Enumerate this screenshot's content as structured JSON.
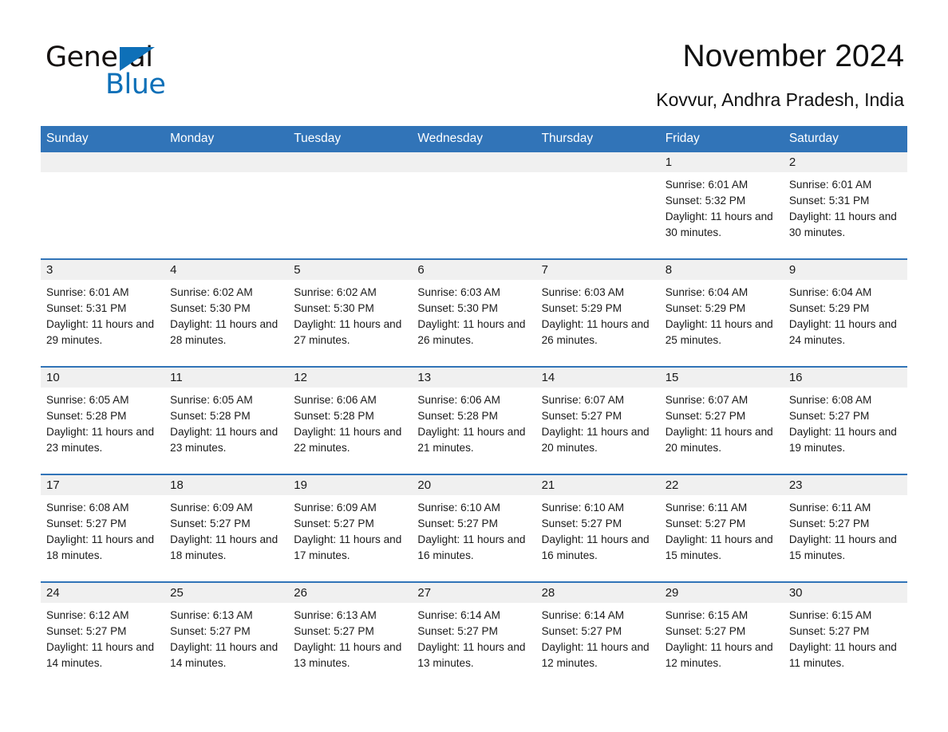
{
  "brand": {
    "name_part1": "General",
    "name_part2": "Blue",
    "accent_color": "#0e70b8"
  },
  "header": {
    "title": "November 2024",
    "location": "Kovvur, Andhra Pradesh, India"
  },
  "calendar": {
    "header_bg": "#3174b8",
    "daynum_bg": "#f0f0f0",
    "weekday_headers": [
      "Sunday",
      "Monday",
      "Tuesday",
      "Wednesday",
      "Thursday",
      "Friday",
      "Saturday"
    ],
    "weeks": [
      [
        {
          "day": "",
          "blank": true,
          "sunrise": "",
          "sunset": "",
          "daylight": ""
        },
        {
          "day": "",
          "blank": true,
          "sunrise": "",
          "sunset": "",
          "daylight": ""
        },
        {
          "day": "",
          "blank": true,
          "sunrise": "",
          "sunset": "",
          "daylight": ""
        },
        {
          "day": "",
          "blank": true,
          "sunrise": "",
          "sunset": "",
          "daylight": ""
        },
        {
          "day": "",
          "blank": true,
          "sunrise": "",
          "sunset": "",
          "daylight": ""
        },
        {
          "day": "1",
          "blank": false,
          "sunrise": "Sunrise: 6:01 AM",
          "sunset": "Sunset: 5:32 PM",
          "daylight": "Daylight: 11 hours and 30 minutes."
        },
        {
          "day": "2",
          "blank": false,
          "sunrise": "Sunrise: 6:01 AM",
          "sunset": "Sunset: 5:31 PM",
          "daylight": "Daylight: 11 hours and 30 minutes."
        }
      ],
      [
        {
          "day": "3",
          "blank": false,
          "sunrise": "Sunrise: 6:01 AM",
          "sunset": "Sunset: 5:31 PM",
          "daylight": "Daylight: 11 hours and 29 minutes."
        },
        {
          "day": "4",
          "blank": false,
          "sunrise": "Sunrise: 6:02 AM",
          "sunset": "Sunset: 5:30 PM",
          "daylight": "Daylight: 11 hours and 28 minutes."
        },
        {
          "day": "5",
          "blank": false,
          "sunrise": "Sunrise: 6:02 AM",
          "sunset": "Sunset: 5:30 PM",
          "daylight": "Daylight: 11 hours and 27 minutes."
        },
        {
          "day": "6",
          "blank": false,
          "sunrise": "Sunrise: 6:03 AM",
          "sunset": "Sunset: 5:30 PM",
          "daylight": "Daylight: 11 hours and 26 minutes."
        },
        {
          "day": "7",
          "blank": false,
          "sunrise": "Sunrise: 6:03 AM",
          "sunset": "Sunset: 5:29 PM",
          "daylight": "Daylight: 11 hours and 26 minutes."
        },
        {
          "day": "8",
          "blank": false,
          "sunrise": "Sunrise: 6:04 AM",
          "sunset": "Sunset: 5:29 PM",
          "daylight": "Daylight: 11 hours and 25 minutes."
        },
        {
          "day": "9",
          "blank": false,
          "sunrise": "Sunrise: 6:04 AM",
          "sunset": "Sunset: 5:29 PM",
          "daylight": "Daylight: 11 hours and 24 minutes."
        }
      ],
      [
        {
          "day": "10",
          "blank": false,
          "sunrise": "Sunrise: 6:05 AM",
          "sunset": "Sunset: 5:28 PM",
          "daylight": "Daylight: 11 hours and 23 minutes."
        },
        {
          "day": "11",
          "blank": false,
          "sunrise": "Sunrise: 6:05 AM",
          "sunset": "Sunset: 5:28 PM",
          "daylight": "Daylight: 11 hours and 23 minutes."
        },
        {
          "day": "12",
          "blank": false,
          "sunrise": "Sunrise: 6:06 AM",
          "sunset": "Sunset: 5:28 PM",
          "daylight": "Daylight: 11 hours and 22 minutes."
        },
        {
          "day": "13",
          "blank": false,
          "sunrise": "Sunrise: 6:06 AM",
          "sunset": "Sunset: 5:28 PM",
          "daylight": "Daylight: 11 hours and 21 minutes."
        },
        {
          "day": "14",
          "blank": false,
          "sunrise": "Sunrise: 6:07 AM",
          "sunset": "Sunset: 5:27 PM",
          "daylight": "Daylight: 11 hours and 20 minutes."
        },
        {
          "day": "15",
          "blank": false,
          "sunrise": "Sunrise: 6:07 AM",
          "sunset": "Sunset: 5:27 PM",
          "daylight": "Daylight: 11 hours and 20 minutes."
        },
        {
          "day": "16",
          "blank": false,
          "sunrise": "Sunrise: 6:08 AM",
          "sunset": "Sunset: 5:27 PM",
          "daylight": "Daylight: 11 hours and 19 minutes."
        }
      ],
      [
        {
          "day": "17",
          "blank": false,
          "sunrise": "Sunrise: 6:08 AM",
          "sunset": "Sunset: 5:27 PM",
          "daylight": "Daylight: 11 hours and 18 minutes."
        },
        {
          "day": "18",
          "blank": false,
          "sunrise": "Sunrise: 6:09 AM",
          "sunset": "Sunset: 5:27 PM",
          "daylight": "Daylight: 11 hours and 18 minutes."
        },
        {
          "day": "19",
          "blank": false,
          "sunrise": "Sunrise: 6:09 AM",
          "sunset": "Sunset: 5:27 PM",
          "daylight": "Daylight: 11 hours and 17 minutes."
        },
        {
          "day": "20",
          "blank": false,
          "sunrise": "Sunrise: 6:10 AM",
          "sunset": "Sunset: 5:27 PM",
          "daylight": "Daylight: 11 hours and 16 minutes."
        },
        {
          "day": "21",
          "blank": false,
          "sunrise": "Sunrise: 6:10 AM",
          "sunset": "Sunset: 5:27 PM",
          "daylight": "Daylight: 11 hours and 16 minutes."
        },
        {
          "day": "22",
          "blank": false,
          "sunrise": "Sunrise: 6:11 AM",
          "sunset": "Sunset: 5:27 PM",
          "daylight": "Daylight: 11 hours and 15 minutes."
        },
        {
          "day": "23",
          "blank": false,
          "sunrise": "Sunrise: 6:11 AM",
          "sunset": "Sunset: 5:27 PM",
          "daylight": "Daylight: 11 hours and 15 minutes."
        }
      ],
      [
        {
          "day": "24",
          "blank": false,
          "sunrise": "Sunrise: 6:12 AM",
          "sunset": "Sunset: 5:27 PM",
          "daylight": "Daylight: 11 hours and 14 minutes."
        },
        {
          "day": "25",
          "blank": false,
          "sunrise": "Sunrise: 6:13 AM",
          "sunset": "Sunset: 5:27 PM",
          "daylight": "Daylight: 11 hours and 14 minutes."
        },
        {
          "day": "26",
          "blank": false,
          "sunrise": "Sunrise: 6:13 AM",
          "sunset": "Sunset: 5:27 PM",
          "daylight": "Daylight: 11 hours and 13 minutes."
        },
        {
          "day": "27",
          "blank": false,
          "sunrise": "Sunrise: 6:14 AM",
          "sunset": "Sunset: 5:27 PM",
          "daylight": "Daylight: 11 hours and 13 minutes."
        },
        {
          "day": "28",
          "blank": false,
          "sunrise": "Sunrise: 6:14 AM",
          "sunset": "Sunset: 5:27 PM",
          "daylight": "Daylight: 11 hours and 12 minutes."
        },
        {
          "day": "29",
          "blank": false,
          "sunrise": "Sunrise: 6:15 AM",
          "sunset": "Sunset: 5:27 PM",
          "daylight": "Daylight: 11 hours and 12 minutes."
        },
        {
          "day": "30",
          "blank": false,
          "sunrise": "Sunrise: 6:15 AM",
          "sunset": "Sunset: 5:27 PM",
          "daylight": "Daylight: 11 hours and 11 minutes."
        }
      ]
    ]
  }
}
